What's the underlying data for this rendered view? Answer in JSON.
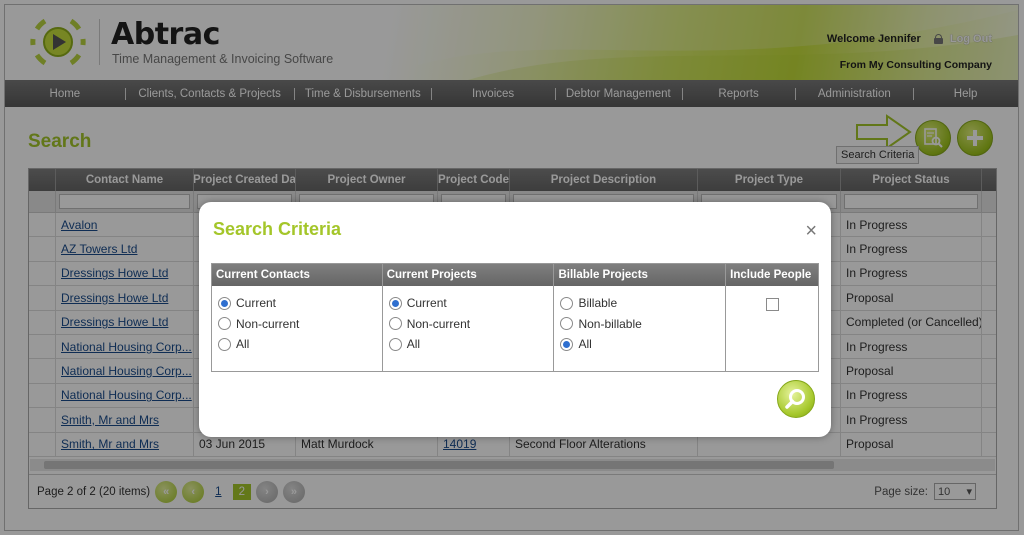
{
  "app": {
    "brand": "Abtrac",
    "tagline": "Time Management & Invoicing Software",
    "welcome": "Welcome Jennifer",
    "logout": "Log Out",
    "company": "From My Consulting Company"
  },
  "nav": [
    {
      "label": "Home"
    },
    {
      "label": "Clients, Contacts & Projects"
    },
    {
      "label": "Time & Disbursements"
    },
    {
      "label": "Invoices"
    },
    {
      "label": "Debtor Management"
    },
    {
      "label": "Reports"
    },
    {
      "label": "Administration"
    },
    {
      "label": "Help"
    }
  ],
  "page": {
    "title": "Search",
    "tooltip": "Search Criteria"
  },
  "grid": {
    "columns": [
      "Contact Name",
      "Project Created Da",
      "Project Owner",
      "Project Code",
      "Project Description",
      "Project Type",
      "Project Status"
    ],
    "rows": [
      {
        "contact": "Avalon",
        "created": "",
        "owner": "",
        "code": "",
        "description": "",
        "type": "",
        "status": "In Progress"
      },
      {
        "contact": "AZ Towers Ltd",
        "created": "",
        "owner": "",
        "code": "",
        "description": "",
        "type": "",
        "status": "In Progress"
      },
      {
        "contact": "Dressings Howe Ltd",
        "created": "",
        "owner": "",
        "code": "",
        "description": "",
        "type": "",
        "status": "In Progress"
      },
      {
        "contact": "Dressings Howe Ltd",
        "created": "",
        "owner": "",
        "code": "",
        "description": "",
        "type": "",
        "status": "Proposal"
      },
      {
        "contact": "Dressings Howe Ltd",
        "created": "",
        "owner": "",
        "code": "",
        "description": "",
        "type": "",
        "status": "Completed (or Cancelled)"
      },
      {
        "contact": "National Housing Corp...",
        "created": "",
        "owner": "",
        "code": "",
        "description": "",
        "type": "",
        "status": "In Progress"
      },
      {
        "contact": "National Housing Corp...",
        "created": "",
        "owner": "",
        "code": "",
        "description": "",
        "type": "",
        "status": "Proposal"
      },
      {
        "contact": "National Housing Corp...",
        "created": "",
        "owner": "",
        "code": "",
        "description": "",
        "type": "",
        "status": "In Progress"
      },
      {
        "contact": "Smith, Mr and Mrs",
        "created": "",
        "owner": "",
        "code": "",
        "description": "",
        "type": "",
        "status": "In Progress"
      },
      {
        "contact": "Smith, Mr and Mrs",
        "created": "03 Jun 2015",
        "owner": "Matt Murdock",
        "code": "14019",
        "description": "Second Floor Alterations",
        "type": "",
        "status": "Proposal"
      }
    ],
    "pager_info": "Page 2 of 2 (20 items)",
    "pages": [
      "1",
      "2"
    ],
    "page_size_label": "Page size:",
    "page_size": "10"
  },
  "modal": {
    "title": "Search Criteria",
    "close": "×",
    "groups": [
      {
        "header": "Current Contacts",
        "options": [
          {
            "label": "Current",
            "checked": true
          },
          {
            "label": "Non-current",
            "checked": false
          },
          {
            "label": "All",
            "checked": false
          }
        ]
      },
      {
        "header": "Current Projects",
        "options": [
          {
            "label": "Current",
            "checked": true
          },
          {
            "label": "Non-current",
            "checked": false
          },
          {
            "label": "All",
            "checked": false
          }
        ]
      },
      {
        "header": "Billable Projects",
        "options": [
          {
            "label": "Billable",
            "checked": false
          },
          {
            "label": "Non-billable",
            "checked": false
          },
          {
            "label": "All",
            "checked": true
          }
        ]
      }
    ],
    "include_people": {
      "header": "Include People",
      "checked": false
    }
  },
  "colors": {
    "accent": "#a4c62a",
    "nav": "#666666",
    "link": "#1a4c8c"
  }
}
